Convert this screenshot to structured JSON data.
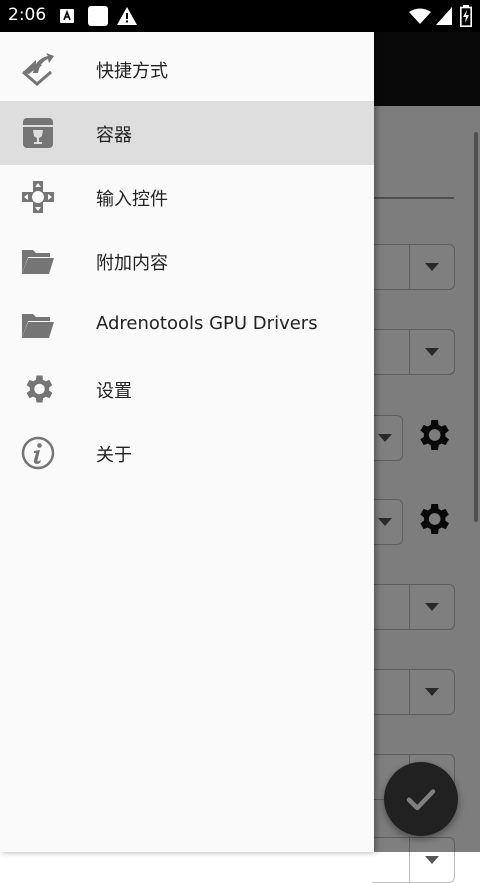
{
  "status_bar": {
    "time": "2:06",
    "icons": [
      "a-notification-icon",
      "square-notification-icon",
      "warning-icon",
      "wifi-icon",
      "signal-icon",
      "battery-charging-icon"
    ]
  },
  "drawer": {
    "items": [
      {
        "label": "快捷方式",
        "icon": "shortcut-icon",
        "selected": false
      },
      {
        "label": "容器",
        "icon": "container-icon",
        "selected": true
      },
      {
        "label": "输入控件",
        "icon": "gamepad-icon",
        "selected": false
      },
      {
        "label": "附加内容",
        "icon": "folder-icon",
        "selected": false
      },
      {
        "label": "Adrenotools GPU Drivers",
        "icon": "folder-icon",
        "selected": false
      },
      {
        "label": "设置",
        "icon": "gear-icon",
        "selected": false
      },
      {
        "label": "关于",
        "icon": "info-icon",
        "selected": false
      }
    ]
  },
  "fab": {
    "icon": "checkmark-icon"
  },
  "colors": {
    "drawer_bg": "#fafafa",
    "selected_bg": "#dedede",
    "icon": "#757575",
    "scrim": "rgba(0,0,0,0.5)"
  }
}
